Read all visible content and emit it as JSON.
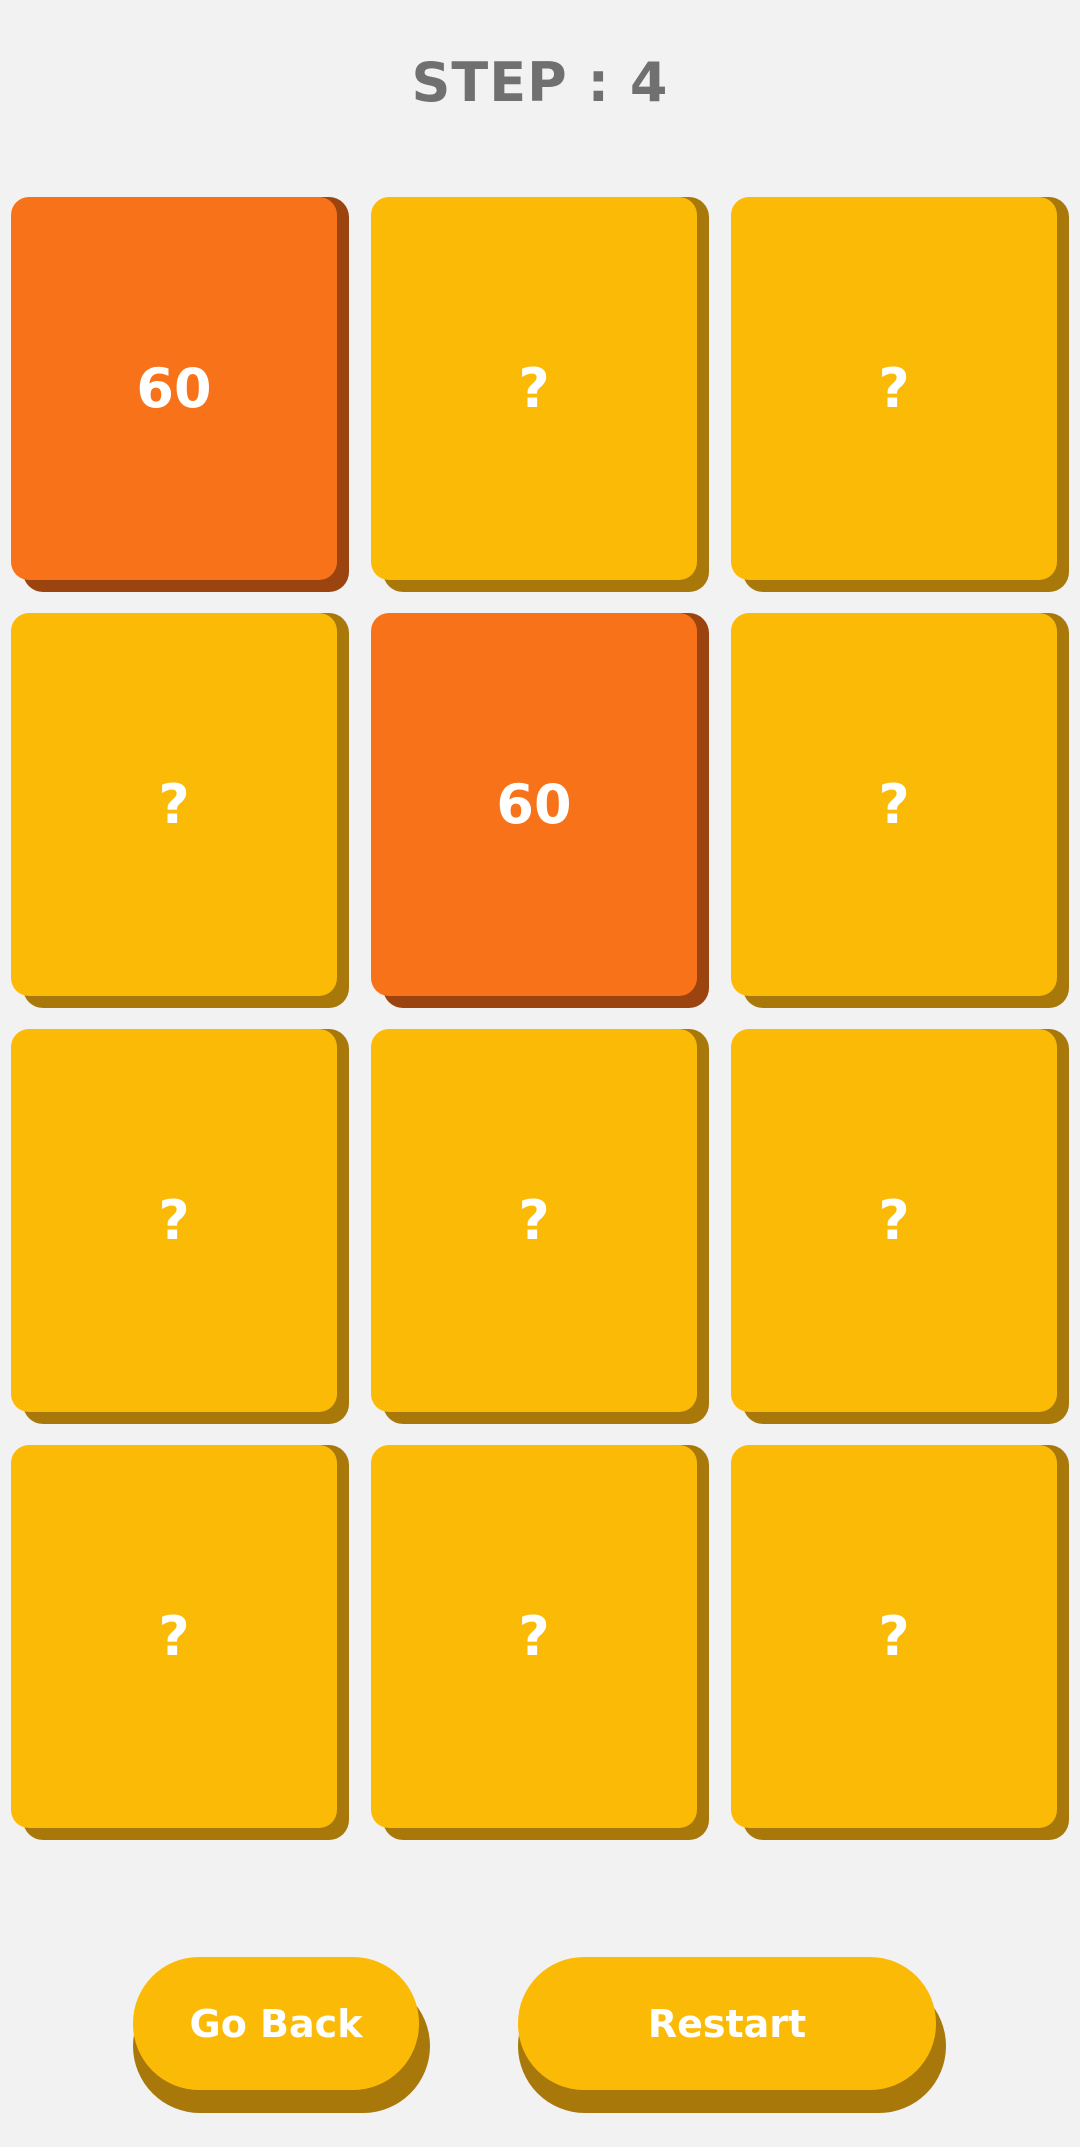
{
  "header": {
    "step_label": "STEP : 4"
  },
  "board": {
    "cards": [
      {
        "label": "60",
        "revealed": true
      },
      {
        "label": "?",
        "revealed": false
      },
      {
        "label": "?",
        "revealed": false
      },
      {
        "label": "?",
        "revealed": false
      },
      {
        "label": "60",
        "revealed": true
      },
      {
        "label": "?",
        "revealed": false
      },
      {
        "label": "?",
        "revealed": false
      },
      {
        "label": "?",
        "revealed": false
      },
      {
        "label": "?",
        "revealed": false
      },
      {
        "label": "?",
        "revealed": false
      },
      {
        "label": "?",
        "revealed": false
      },
      {
        "label": "?",
        "revealed": false
      }
    ]
  },
  "buttons": {
    "go_back_label": "Go Back",
    "restart_label": "Restart"
  },
  "colors": {
    "background": "#f2f2f2",
    "card_hidden": "#fbba05",
    "card_hidden_shadow": "#a8780a",
    "card_revealed": "#f8721a",
    "card_revealed_shadow": "#9c4410",
    "title_text": "#707070",
    "card_text": "#ffffff"
  }
}
